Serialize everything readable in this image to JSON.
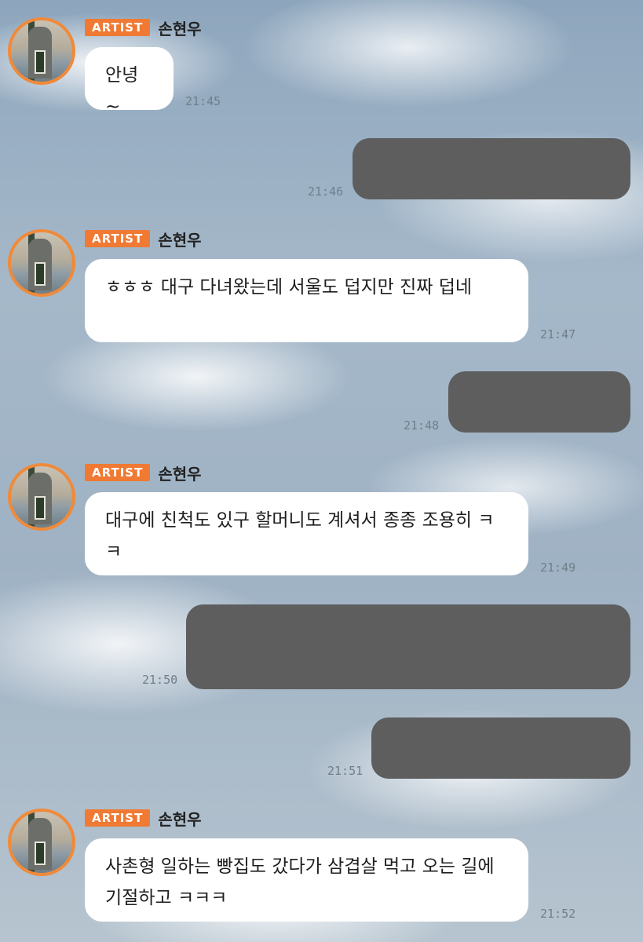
{
  "sender": {
    "badge": "ARTIST",
    "name": "손현우"
  },
  "messages": [
    {
      "from": "artist",
      "text": "안녕~",
      "time": "21:45"
    },
    {
      "from": "me",
      "text": "",
      "time": "21:46"
    },
    {
      "from": "artist",
      "text": "ㅎㅎㅎ 대구 다녀왔는데 서울도 덥지만 진짜 덥네",
      "time": "21:47"
    },
    {
      "from": "me",
      "text": "",
      "time": "21:48"
    },
    {
      "from": "artist",
      "text": "대구에 친척도 있구 할머니도 계셔서 종종 조용히 ㅋㅋ",
      "time": "21:49"
    },
    {
      "from": "me",
      "text": "",
      "time": "21:50"
    },
    {
      "from": "me",
      "text": "",
      "time": "21:51"
    },
    {
      "from": "artist",
      "text": "사촌형 일하는 빵집도 갔다가 삼겹살 먹고 오는 길에 기절하고 ㅋㅋㅋ",
      "time": "21:52"
    }
  ],
  "colors": {
    "badge": "#f07a33",
    "avatar_ring": "#f08a3a",
    "my_bubble": "#5e5e5e",
    "artist_bubble": "#ffffff"
  }
}
